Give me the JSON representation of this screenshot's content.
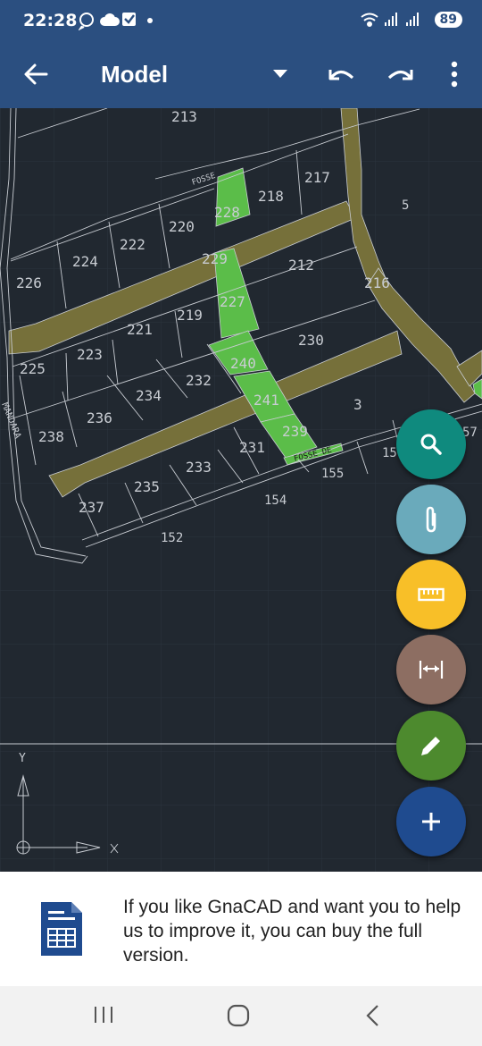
{
  "status_bar": {
    "time": "22:28",
    "battery": "89",
    "left_icons": [
      "whatsapp-icon",
      "cloud-icon",
      "check-box-icon",
      "dot-icon"
    ],
    "right_icons": [
      "wifi-icon",
      "signal-icon",
      "signal-icon"
    ]
  },
  "app_bar": {
    "title": "Model",
    "icons": [
      "back-arrow-icon",
      "dropdown-triangle-icon",
      "undo-icon",
      "redo-icon",
      "more-vertical-icon"
    ]
  },
  "drawing": {
    "parcels": [
      "213",
      "217",
      "218",
      "228",
      "220",
      "222",
      "224",
      "226",
      "229",
      "212",
      "216",
      "227",
      "219",
      "221",
      "223",
      "225",
      "230",
      "240",
      "232",
      "234",
      "236",
      "238",
      "241",
      "3",
      "239",
      "231",
      "233",
      "235",
      "237",
      "154",
      "155",
      "152",
      "5",
      "15",
      "57"
    ],
    "text_labels": [
      "FOSSE",
      "FOSSE DE",
      "MANDARA"
    ],
    "axis_labels": {
      "x": "X",
      "y": "Y"
    },
    "colors": {
      "background": "#212830",
      "road": "#76703a",
      "highlight": "#5bbd49",
      "line": "#c8ccd2"
    }
  },
  "fab_buttons": [
    {
      "name": "search",
      "icon": "search-icon",
      "color": "#0f8a7e"
    },
    {
      "name": "attach",
      "icon": "paperclip-icon",
      "color": "#6aaabb"
    },
    {
      "name": "ruler",
      "icon": "ruler-icon",
      "color": "#f8bf28"
    },
    {
      "name": "measure",
      "icon": "dimension-icon",
      "color": "#8d6e62"
    },
    {
      "name": "edit",
      "icon": "pencil-icon",
      "color": "#4d8a2e"
    },
    {
      "name": "add",
      "icon": "plus-icon",
      "color": "#1f4b8f"
    }
  ],
  "banner": {
    "message": "If you like GnaCAD and want you to help us to improve it, you can buy the full version.",
    "icon": "spreadsheet-document-icon"
  },
  "nav_bar": {
    "icons": [
      "recent-apps-icon",
      "home-icon",
      "back-icon"
    ]
  }
}
